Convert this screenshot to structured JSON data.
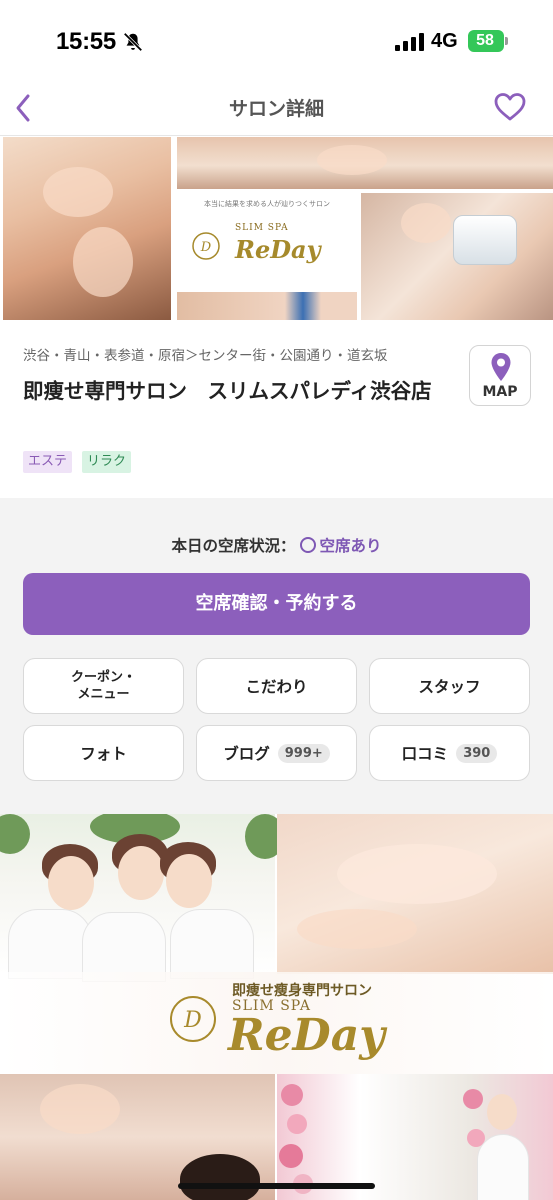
{
  "status_bar": {
    "time": "15:55",
    "network": "4G",
    "battery": "58",
    "icons": [
      "bell-slash-icon",
      "signal-icon",
      "battery-icon"
    ]
  },
  "nav": {
    "title": "サロン詳細",
    "back_icon": "chevron-left-icon",
    "favorite_icon": "heart-icon",
    "accent_color": "#8c5fbc"
  },
  "hero": {
    "logo_tagline": "本当に結果を求める人が辿りつくサロン",
    "logo_small": "SLIM SPA",
    "logo_brand": "ReDay"
  },
  "salon": {
    "area": "渋谷・青山・表参道・原宿＞センター街・公園通り・道玄坂",
    "name": "即痩せ専門サロン　スリムスパレディ渋谷店",
    "map_label": "MAP",
    "tags": [
      "エステ",
      "リラク"
    ]
  },
  "reservation": {
    "vacancy_label": "本日の空席状況：",
    "vacancy_status": "空席あり",
    "reserve_button": "空席確認・予約する"
  },
  "menu": {
    "coupon_line1": "クーポン・",
    "coupon_line2": "メニュー",
    "kodawari": "こだわり",
    "staff": "スタッフ",
    "photo": "フォト",
    "blog": "ブログ",
    "blog_count": "999+",
    "review": "口コミ",
    "review_count": "390"
  },
  "gallery": {
    "banner_tagline": "即痩せ瘦身専門サロン",
    "banner_small": "SLIM SPA",
    "banner_brand": "ReDay"
  }
}
